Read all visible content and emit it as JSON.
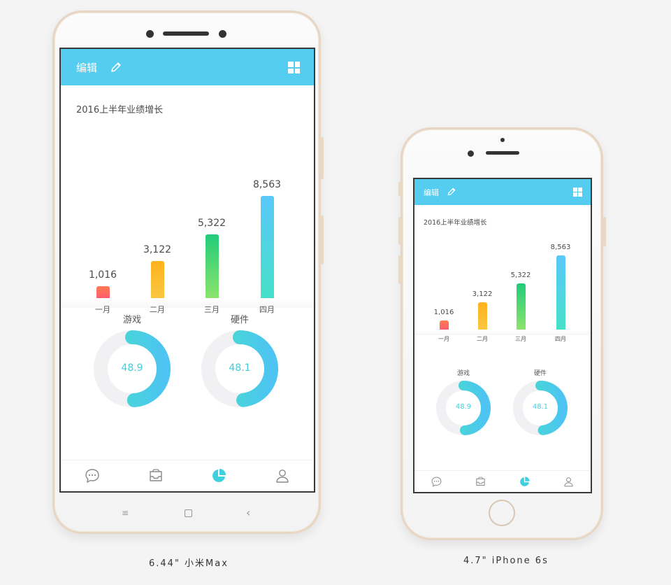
{
  "header": {
    "title": "编辑"
  },
  "chart_data": {
    "type": "bar",
    "title": "2016上半年业绩增长",
    "categories": [
      "一月",
      "二月",
      "三月",
      "四月"
    ],
    "values": [
      1016,
      3122,
      5322,
      8563
    ],
    "value_labels": [
      "1,016",
      "3,122",
      "5,322",
      "8,563"
    ],
    "ylim": [
      0,
      8563
    ],
    "bar_gradients": [
      [
        "#ff7a52",
        "#ff5f6d"
      ],
      [
        "#ffb21c",
        "#f9c740"
      ],
      [
        "#22cc7a",
        "#8be46c"
      ],
      [
        "#5ac8fa",
        "#46e0c8"
      ]
    ]
  },
  "donuts": [
    {
      "title": "游戏",
      "value": 48.9,
      "display": "48.9"
    },
    {
      "title": "硬件",
      "value": 48.1,
      "display": "48.1"
    }
  ],
  "donut_colors": {
    "track": "#f1f1f4",
    "start": "#46e0c8",
    "end": "#4dc4f2"
  },
  "tabs": [
    {
      "icon": "message-icon"
    },
    {
      "icon": "inbox-icon"
    },
    {
      "icon": "pie-chart-icon",
      "active": true
    },
    {
      "icon": "user-icon"
    }
  ],
  "captions": {
    "left": "6.44\" 小米Max",
    "right": "4.7\" iPhone 6s"
  },
  "colors": {
    "header": "#54cdf0",
    "accent": "#3fd0dd",
    "bezel": "#e7d6c3"
  }
}
